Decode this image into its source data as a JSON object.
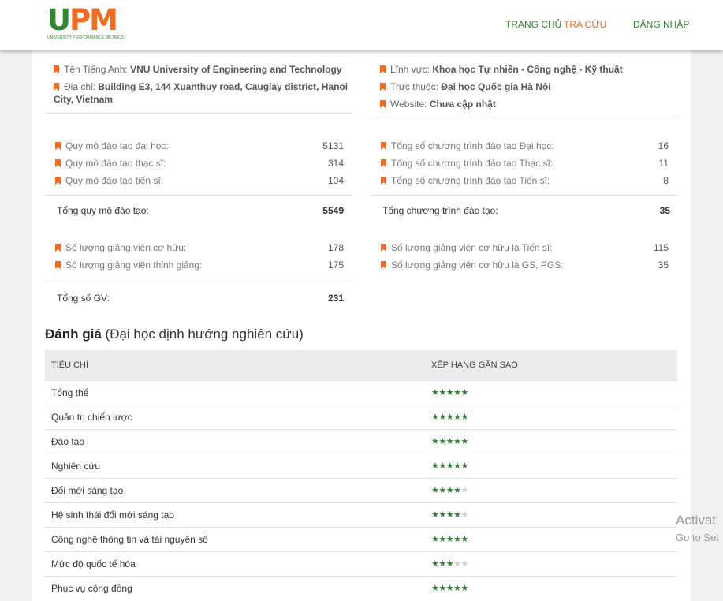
{
  "header": {
    "logo_text_u": "U",
    "logo_text_pm": "PM",
    "logo_sub": "UNIVERSITY PERFORMANCE METRICS",
    "nav": {
      "home": "TRANG CHỦ",
      "search": "TRA CỨU",
      "login": "ĐĂNG NHẬP"
    }
  },
  "info": {
    "left": [
      {
        "label": "Tên Tiếng Anh: ",
        "value": "VNU University of Engineering and Technology"
      },
      {
        "label": "Địa chỉ: ",
        "value": "Building E3, 144 Xuanthuy road, Caugiay district, Hanoi City, Vietnam"
      }
    ],
    "right": [
      {
        "label": "Lĩnh vực: ",
        "value": "Khoa học Tự nhiên - Công nghệ - Kỹ thuật"
      },
      {
        "label": "Trực thuộc: ",
        "value": "Đại học Quốc gia Hà Nội"
      },
      {
        "label": "Website: ",
        "value": "Chưa cập nhật"
      }
    ]
  },
  "training_scale": {
    "items": [
      {
        "label": "Quy mô đào tạo đại học:",
        "value": "5131"
      },
      {
        "label": "Quy mô đào tạo thạc sĩ:",
        "value": "314"
      },
      {
        "label": "Quy mô đào tạo tiến sĩ:",
        "value": "104"
      }
    ],
    "total_label": "Tổng quy mô đào tạo:",
    "total_value": "5549"
  },
  "programs": {
    "items": [
      {
        "label": "Tổng số chương trình đào tạo Đại học:",
        "value": "16"
      },
      {
        "label": "Tổng số chương trình đào tạo Thạc sĩ:",
        "value": "11"
      },
      {
        "label": "Tổng số chương trình đào tạo Tiến sĩ:",
        "value": "8"
      }
    ],
    "total_label": "Tổng chương trình đào tạo:",
    "total_value": "35"
  },
  "lecturers": {
    "items": [
      {
        "label": "Số lượng giảng viên cơ hữu:",
        "value": "178"
      },
      {
        "label": "Số lượng giảng viên thỉnh giảng:",
        "value": "175"
      }
    ],
    "total_label": "Tổng số GV:",
    "total_value": "231"
  },
  "lecturer_degrees": {
    "items": [
      {
        "label": "Số lượng giảng viên cơ hữu là Tiến sĩ:",
        "value": "115"
      },
      {
        "label": "Số lượng giảng viên cơ hữu là GS, PGS:",
        "value": "35"
      }
    ]
  },
  "evaluation": {
    "title": "Đánh giá",
    "subtitle": "(Đại học định hướng nghiên cứu)",
    "col_criteria": "TIÊU CHÍ",
    "col_rating": "XẾP HẠNG GẮN SAO",
    "rows": [
      {
        "name": "Tổng thể",
        "stars": 5
      },
      {
        "name": "Quản trị chiến lược",
        "stars": 5
      },
      {
        "name": "Đào tạo",
        "stars": 5
      },
      {
        "name": "Nghiên cứu",
        "stars": 5
      },
      {
        "name": "Đổi mới sáng tạo",
        "stars": 4
      },
      {
        "name": "Hệ sinh thái đổi mới sáng tạo",
        "stars": 4
      },
      {
        "name": "Công nghệ thông tin và tài nguyên số",
        "stars": 5
      },
      {
        "name": "Mức độ quốc tế hóa",
        "stars": 3
      },
      {
        "name": "Phục vụ cộng đồng",
        "stars": 5
      }
    ],
    "max_stars": 5
  },
  "watermark": {
    "line1": "Activat",
    "line2": "Go to Set"
  },
  "colors": {
    "brand_green": "#2e7d32",
    "brand_orange": "#f26b21"
  }
}
